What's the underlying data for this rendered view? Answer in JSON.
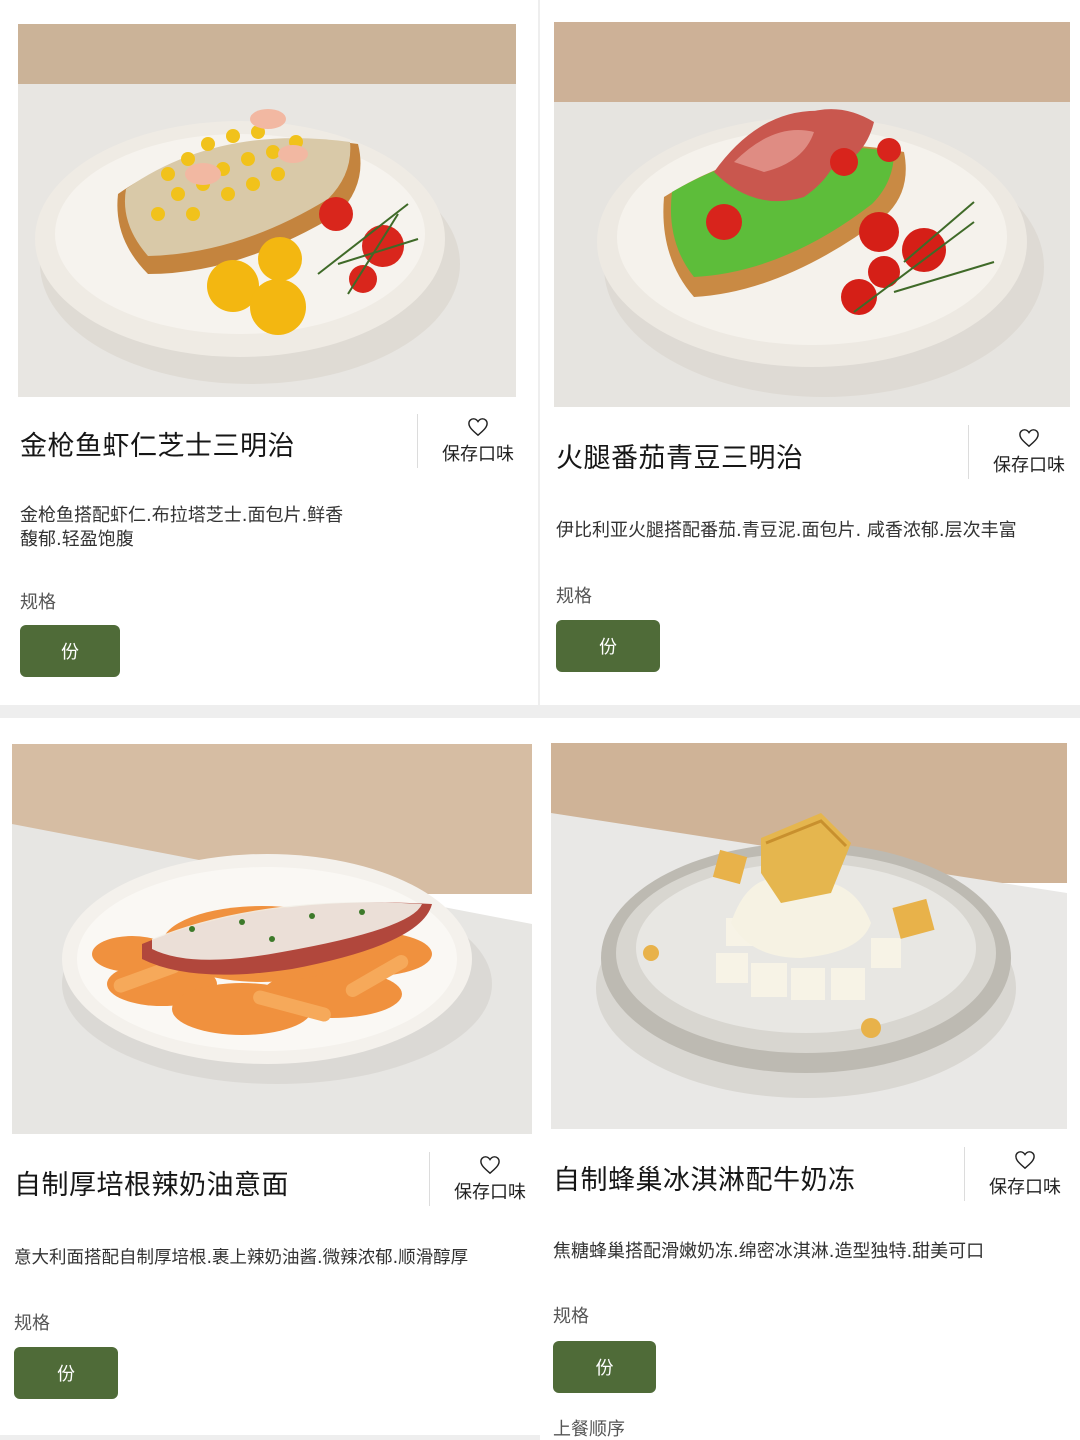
{
  "common": {
    "fav_label": "保存口味",
    "spec_label": "规格",
    "spec_option": "份",
    "order_label": "上餐顺序",
    "accent_color": "#4f6b38",
    "icons": {
      "favorite": "heart-icon"
    }
  },
  "items": [
    {
      "name": "金枪鱼虾仁芝士三明治",
      "description": "金枪鱼搭配虾仁.布拉塔芝士.面包片.鲜香馥郁.轻盈饱腹"
    },
    {
      "name": "火腿番茄青豆三明治",
      "description": "伊比利亚火腿搭配番茄.青豆泥.面包片. 咸香浓郁.层次丰富"
    },
    {
      "name": "自制厚培根辣奶油意面",
      "description": "意大利面搭配自制厚培根.裹上辣奶油酱.微辣浓郁.顺滑醇厚"
    },
    {
      "name": "自制蜂巢冰淇淋配牛奶冻",
      "description": "焦糖蜂巢搭配滑嫩奶冻.绵密冰淇淋.造型独特.甜美可口"
    }
  ]
}
